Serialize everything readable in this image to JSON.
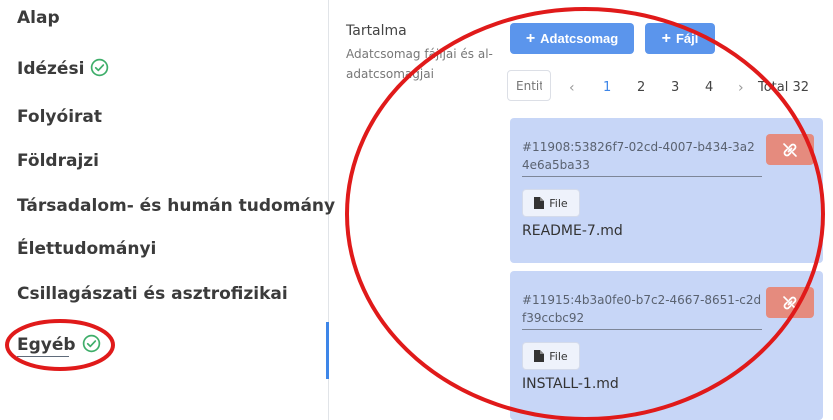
{
  "sidebar": {
    "items": [
      {
        "label": "Alap"
      },
      {
        "label": "Idézési"
      },
      {
        "label": "Folyóirat"
      },
      {
        "label": "Földrajzi"
      },
      {
        "label": "Társadalom- és humán tudomány"
      },
      {
        "label": "Élettudományi"
      },
      {
        "label": "Csillagászati és asztrofizikai"
      },
      {
        "label": "Egyéb"
      }
    ]
  },
  "contents": {
    "title": "Tartalma",
    "description": "Adatcsomag fájljai és al-adatcsomagjai",
    "add_dataset_label": "Adatcsomag",
    "add_file_label": "Fájl",
    "filter_placeholder": "Entit",
    "pagination": {
      "pages": [
        "1",
        "2",
        "3",
        "4"
      ],
      "current": "1",
      "total": "Total 32"
    },
    "items": [
      {
        "id": "#11908:53826f7-02cd-4007-b434-3a24e6a5ba33",
        "file_button": "File",
        "file_name": "README-7.md"
      },
      {
        "id": "#11915:4b3a0fe0-b7c2-4667-8651-c2df39ccbc92",
        "file_button": "File",
        "file_name": "INSTALL-1.md"
      }
    ]
  },
  "colors": {
    "primary": "#5b95ec",
    "card_bg": "#c7d6f7",
    "danger": "#e58b7e",
    "success": "#3fae6a",
    "annotation": "#e01a1a"
  },
  "icons": [
    "check-circle-icon",
    "plus-icon",
    "unlink-icon",
    "document-icon",
    "chevron-left-icon",
    "chevron-right-icon"
  ]
}
